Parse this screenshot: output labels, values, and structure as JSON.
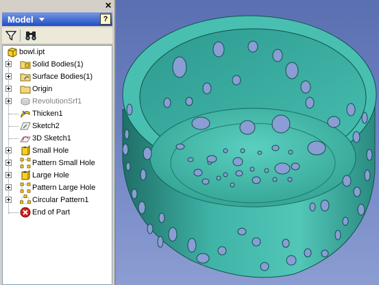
{
  "panel": {
    "close_icon": "close-icon",
    "title": "Model",
    "help_label": "?",
    "filter_icon": "filter-icon",
    "find_icon": "binoculars-icon"
  },
  "tree": {
    "items": [
      {
        "label": "bowl.ipt",
        "icon": "part-icon",
        "expander": false,
        "disabled": false
      },
      {
        "label": "Solid Bodies(1)",
        "icon": "solid-bodies-folder-icon",
        "expander": true,
        "disabled": false
      },
      {
        "label": "Surface Bodies(1)",
        "icon": "surface-bodies-folder-icon",
        "expander": true,
        "disabled": false
      },
      {
        "label": "Origin",
        "icon": "folder-icon",
        "expander": true,
        "disabled": false
      },
      {
        "label": "RevolutionSrf1",
        "icon": "revolution-icon",
        "expander": true,
        "disabled": true
      },
      {
        "label": "Thicken1",
        "icon": "thicken-icon",
        "expander": false,
        "disabled": false
      },
      {
        "label": "Sketch2",
        "icon": "sketch-icon",
        "expander": false,
        "disabled": false
      },
      {
        "label": "3D Sketch1",
        "icon": "3d-sketch-icon",
        "expander": false,
        "disabled": false
      },
      {
        "label": "Small Hole",
        "icon": "hole-icon",
        "expander": true,
        "disabled": false
      },
      {
        "label": "Pattern Small Hole",
        "icon": "rect-pattern-icon",
        "expander": true,
        "disabled": false
      },
      {
        "label": "Large Hole",
        "icon": "hole-icon",
        "expander": true,
        "disabled": false
      },
      {
        "label": "Pattern Large Hole",
        "icon": "rect-pattern-icon",
        "expander": true,
        "disabled": false
      },
      {
        "label": "Circular Pattern1",
        "icon": "circular-pattern-icon",
        "expander": true,
        "disabled": false
      },
      {
        "label": "End of Part",
        "icon": "end-of-part-icon",
        "expander": false,
        "disabled": false
      }
    ]
  },
  "viewport": {
    "subject": "perforated-bowl-3d-model",
    "background": "#6a7fbf",
    "model_color": "#3cb4a8"
  }
}
